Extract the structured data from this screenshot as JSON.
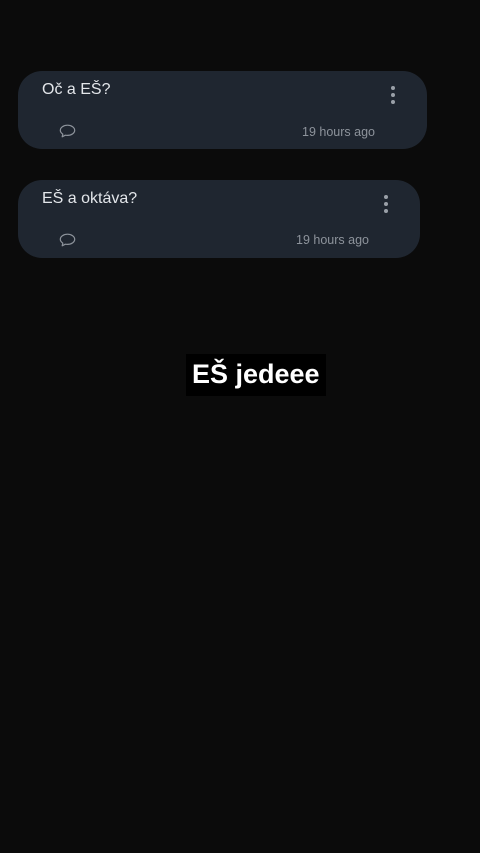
{
  "posts": [
    {
      "title": "Oč a EŠ?",
      "time": "19 hours ago",
      "comment_icon": "comment-bubble-icon",
      "more_icon": "more-vertical-icon"
    },
    {
      "title": "EŠ a oktáva?",
      "time": "19 hours ago",
      "comment_icon": "comment-bubble-icon",
      "more_icon": "more-vertical-icon"
    }
  ],
  "caption": "EŠ jedeee",
  "colors": {
    "background": "#0b0b0b",
    "card": "#1f2630",
    "title_text": "#e3e6ea",
    "meta_text": "#8d939b",
    "caption_bg": "#000000",
    "caption_text": "#ffffff"
  }
}
